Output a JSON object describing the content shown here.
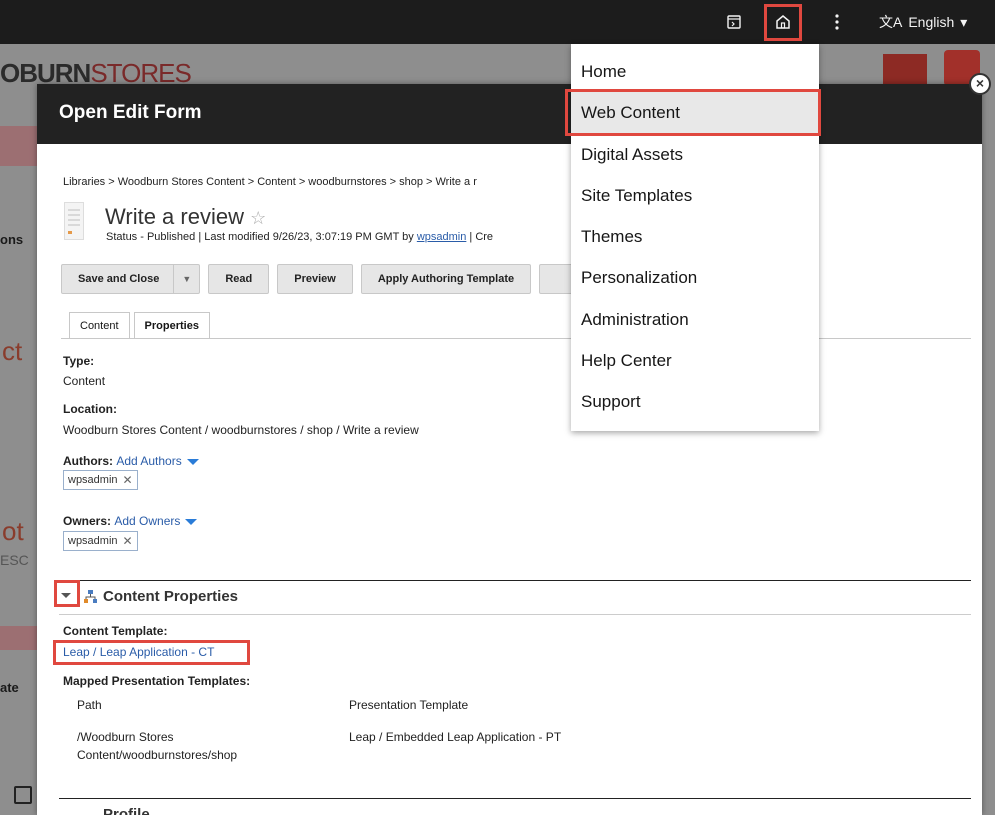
{
  "topbar": {
    "language_label": "English",
    "language_icon_glyph": "文A"
  },
  "background": {
    "logo_bold": "OBURN",
    "logo_thin": "STORES",
    "snippet_1": "ons",
    "snippet_2": "ct",
    "snippet_3": "ot",
    "snippet_4": "ESC",
    "snippet_5": "ate"
  },
  "modal": {
    "title": "Open Edit Form",
    "breadcrumb": "Libraries > Woodburn Stores Content > Content > woodburnstores > shop > Write a r",
    "item_title": "Write a review",
    "status_prefix": "Status - Published | Last modified 9/26/23, 3:07:19 PM GMT by ",
    "status_user": "wpsadmin",
    "status_suffix": " | Cre",
    "buttons": {
      "save_close": "Save and Close",
      "read": "Read",
      "preview": "Preview",
      "apply_template": "Apply Authoring Template"
    },
    "tabs": {
      "content": "Content",
      "properties": "Properties"
    },
    "type_label": "Type:",
    "type_value": "Content",
    "location_label": "Location:",
    "location_value": "Woodburn Stores Content / woodburnstores / shop / Write a review",
    "authors_label": "Authors:",
    "authors_add": "Add Authors",
    "authors_chip": "wpsadmin",
    "owners_label": "Owners:",
    "owners_add": "Add Owners",
    "owners_chip": "wpsadmin",
    "content_properties_title": "Content Properties",
    "content_template_label": "Content Template:",
    "content_template_value": "Leap / Leap Application - CT",
    "mapped_label": "Mapped Presentation Templates:",
    "col_path": "Path",
    "col_presentation": "Presentation Template",
    "row_path_line1": "/Woodburn Stores",
    "row_path_line2": "Content/woodburnstores/shop",
    "row_presentation": "Leap / Embedded Leap Application - PT",
    "profile_title": "Profile"
  },
  "menu": {
    "items": [
      "Home",
      "Web Content",
      "Digital Assets",
      "Site Templates",
      "Themes",
      "Personalization",
      "Administration",
      "Help Center",
      "Support"
    ],
    "selected_index": 1
  },
  "colors": {
    "highlight": "#e0483f",
    "link": "#2a5ca8",
    "topbar": "#1c1c1c"
  }
}
